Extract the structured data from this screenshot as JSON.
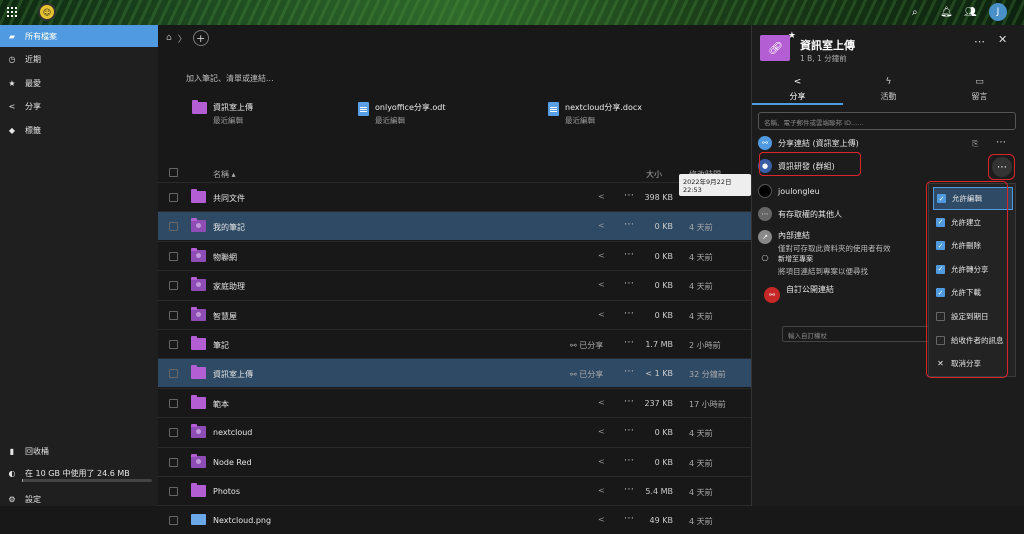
{
  "topbar": {
    "avatar_letter": "J"
  },
  "sidebar": {
    "items": [
      {
        "label": "所有檔案",
        "icon": "folder-icon"
      },
      {
        "label": "近期",
        "icon": "clock-icon"
      },
      {
        "label": "最愛",
        "icon": "star-icon"
      },
      {
        "label": "分享",
        "icon": "share-icon"
      },
      {
        "label": "標籤",
        "icon": "tag-icon"
      }
    ],
    "trash": "回收桶",
    "quota": "在 10 GB 中使用了 24.6 MB",
    "settings": "設定"
  },
  "main": {
    "notes_hint": "加入筆記、清單或連結...",
    "recent": [
      {
        "name": "資訊室上傳",
        "sub": "最近編輯"
      },
      {
        "name": "onlyoffice分享.odt",
        "sub": "最近編輯"
      },
      {
        "name": "nextcloud分享.docx",
        "sub": "最近編輯"
      }
    ],
    "header": {
      "name": "名稱",
      "size": "大小",
      "modified": "修改時間"
    },
    "tooltip": "2022年9月22日 22:53",
    "rows": [
      {
        "name": "共同文件",
        "size": "398 KB",
        "mod": "",
        "shared": ""
      },
      {
        "name": "我的筆記",
        "size": "0 KB",
        "mod": "4 天前",
        "shared": ""
      },
      {
        "name": "物聯網",
        "size": "0 KB",
        "mod": "4 天前",
        "shared": ""
      },
      {
        "name": "家庭助理",
        "size": "0 KB",
        "mod": "4 天前",
        "shared": ""
      },
      {
        "name": "智慧屋",
        "size": "0 KB",
        "mod": "4 天前",
        "shared": ""
      },
      {
        "name": "筆記",
        "size": "1.7 MB",
        "mod": "2 小時前",
        "shared": "已分享"
      },
      {
        "name": "資訊室上傳",
        "size": "< 1 KB",
        "mod": "32 分鐘前",
        "shared": "已分享"
      },
      {
        "name": "範本",
        "size": "237 KB",
        "mod": "17 小時前",
        "shared": ""
      },
      {
        "name": "nextcloud",
        "size": "0 KB",
        "mod": "4 天前",
        "shared": ""
      },
      {
        "name": "Node Red",
        "size": "0 KB",
        "mod": "4 天前",
        "shared": ""
      },
      {
        "name": "Photos",
        "size": "5.4 MB",
        "mod": "4 天前",
        "shared": ""
      },
      {
        "name": "Nextcloud.png",
        "size": "49 KB",
        "mod": "4 天前",
        "shared": ""
      }
    ]
  },
  "panel": {
    "title": "資訊室上傳",
    "subtitle": "1 B, 1 分鐘前",
    "tabs": [
      {
        "label": "分享",
        "icon": "share-icon"
      },
      {
        "label": "活動",
        "icon": "activity-icon"
      },
      {
        "label": "留言",
        "icon": "comment-icon"
      }
    ],
    "search_placeholder": "名稱、電子郵件或雲端聯邦 ID......",
    "share_link": "分享連結 (資訊室上傳)",
    "group": "資訊研發 (群組)",
    "user": "joulongleu",
    "others": "有存取權的其他人",
    "internal_title": "內部連結",
    "internal_sub": "僅對可存取此資料夾的使用者有效",
    "project_title": "新增至專案",
    "project_sub": "將項目連結到專案以便尋找",
    "custom_link": "自訂公開連結",
    "custom_placeholder": "輸入自訂權杖",
    "menu": [
      {
        "label": "允許編輯",
        "checked": true
      },
      {
        "label": "允許建立",
        "checked": true
      },
      {
        "label": "允許刪除",
        "checked": true
      },
      {
        "label": "允許轉分享",
        "checked": true
      },
      {
        "label": "允許下載",
        "checked": true
      },
      {
        "label": "設定到期日",
        "checked": false
      },
      {
        "label": "給收件者的訊息",
        "checked": false
      },
      {
        "label": "取消分享",
        "checked": null
      }
    ]
  }
}
